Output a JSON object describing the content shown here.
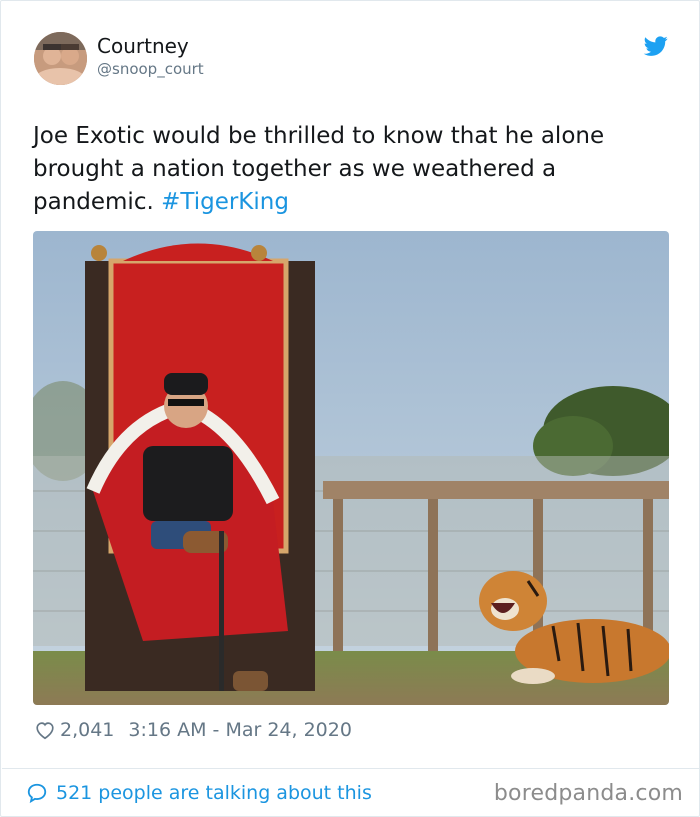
{
  "tweet": {
    "author": {
      "display_name": "Courtney",
      "handle": "@snoop_court"
    },
    "text_before_hashtag": "Joe Exotic would be thrilled to know that he alone brought a nation together as we weathered a pandemic.",
    "hashtag": "#TigerKing",
    "likes": "2,041",
    "timestamp": "3:16 AM - Mar 24, 2020",
    "conversation_label": "521 people are talking about this",
    "icons": {
      "platform": "twitter-bird-icon",
      "like": "heart-icon",
      "reply": "speech-bubble-icon"
    },
    "colors": {
      "accent": "#1b95e0",
      "muted": "#657786",
      "text": "#14171a"
    }
  },
  "watermark": "boredpanda.com"
}
